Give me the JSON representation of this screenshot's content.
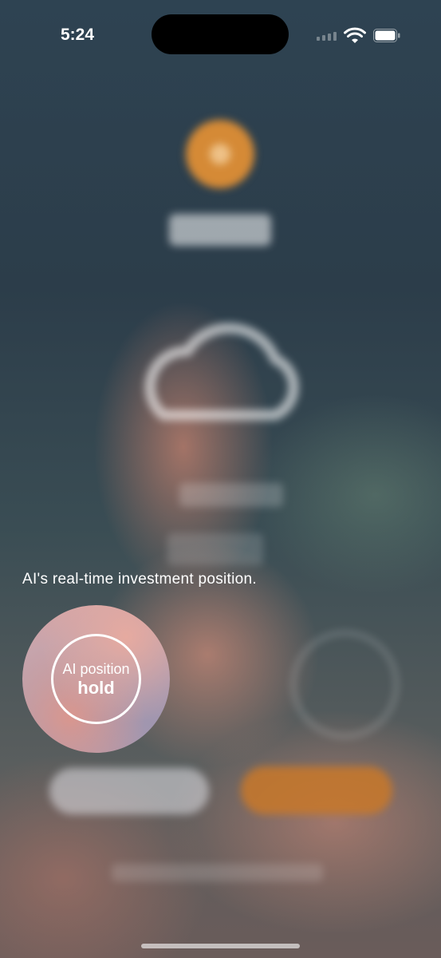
{
  "status_bar": {
    "time": "5:24"
  },
  "onboarding": {
    "hint_text": "AI's real-time investment position.",
    "ai_position": {
      "label": "AI position",
      "value": "hold"
    }
  },
  "colors": {
    "accent_orange": "#d58a36",
    "background": "#2c3f4b"
  },
  "icons": [
    "wifi-icon",
    "battery-icon",
    "signal-icon",
    "cloud-icon"
  ]
}
